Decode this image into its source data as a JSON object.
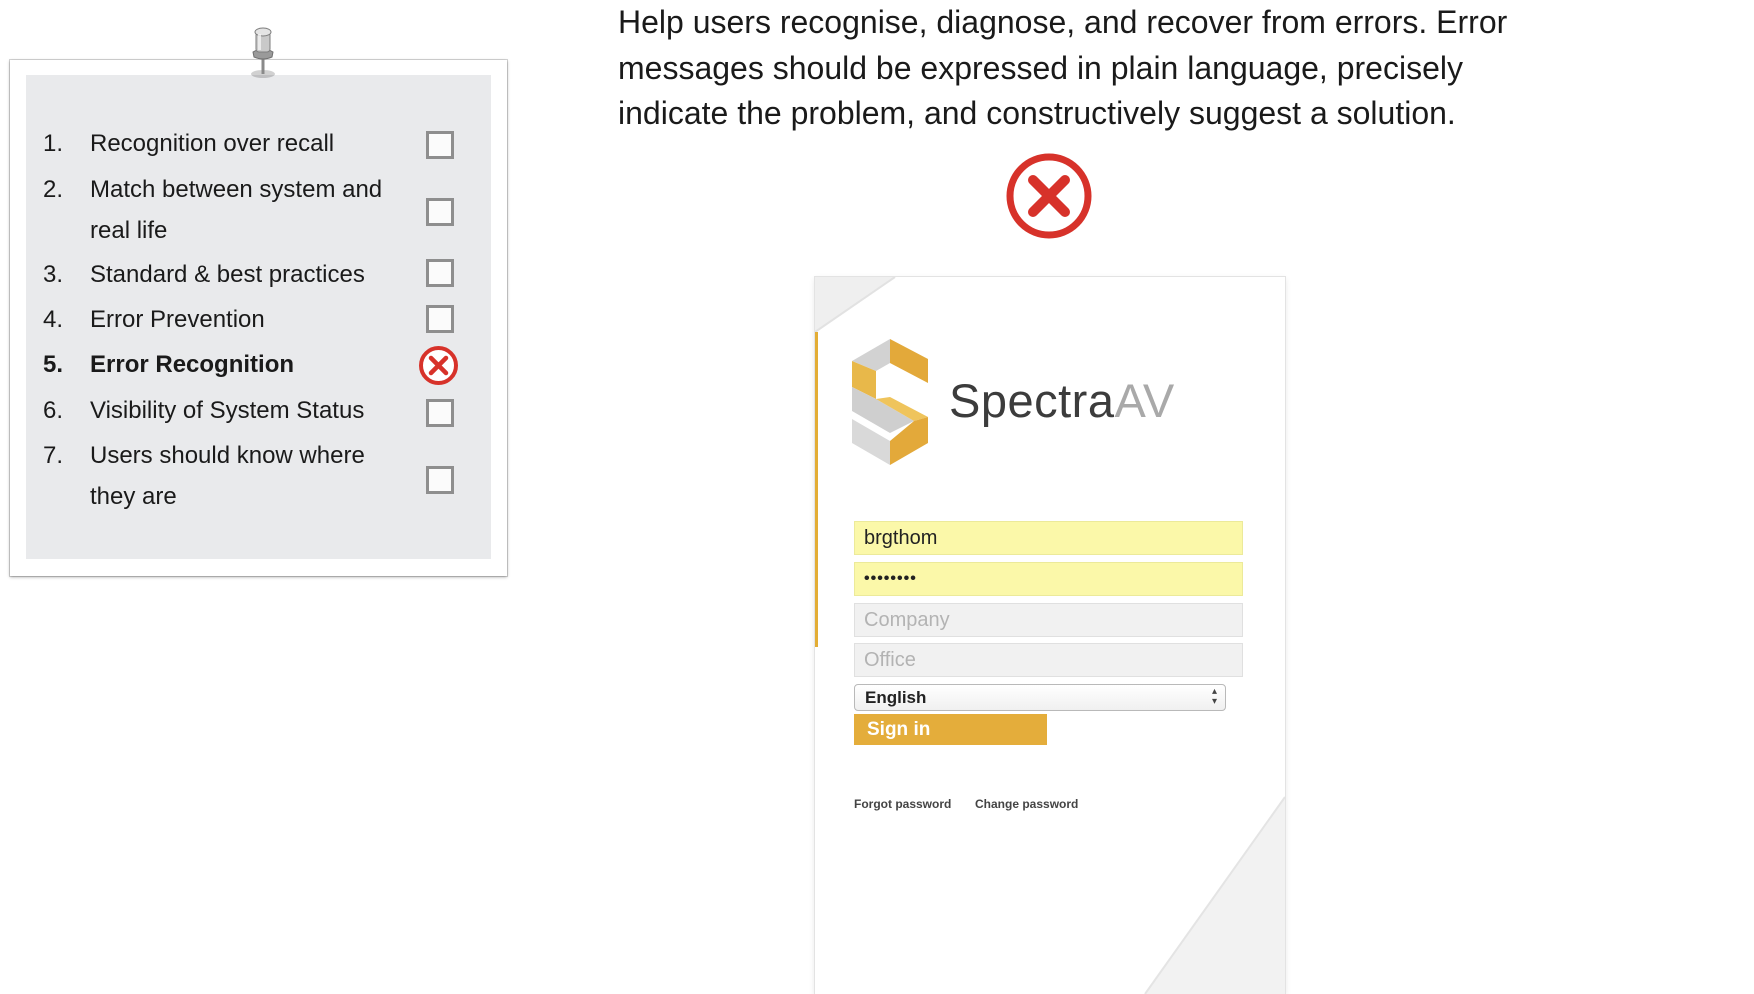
{
  "checklist": {
    "items": [
      {
        "num": "1.",
        "text": "Recognition over recall",
        "status": "unchecked"
      },
      {
        "num": "2.",
        "text": "Match between system and real life",
        "status": "unchecked"
      },
      {
        "num": "3.",
        "text": "Standard & best practices",
        "status": "unchecked"
      },
      {
        "num": "4.",
        "text": "Error Prevention",
        "status": "unchecked"
      },
      {
        "num": "5.",
        "text": "Error Recognition",
        "status": "failed"
      },
      {
        "num": "6.",
        "text": "Visibility of System Status",
        "status": "unchecked"
      },
      {
        "num": "7.",
        "text": "Users should know where they are",
        "status": "unchecked"
      }
    ]
  },
  "heading": {
    "text": "Help users recognise, diagnose, and recover from errors. Error\nmessages should be expressed in plain language, precisely\nindicate the problem, and constructively suggest a solution."
  },
  "status_icon": {
    "name": "error-x-icon",
    "color": "#d7322a"
  },
  "login": {
    "brand_main": "Spectra",
    "brand_suffix": "AV",
    "username_value": "brgthom",
    "password_value": "••••••••",
    "company_placeholder": "Company",
    "office_placeholder": "Office",
    "language_selected": "English",
    "signin_label": "Sign in",
    "forgot_label": "Forgot password",
    "change_label": "Change password",
    "accent_color": "#e4ad3b",
    "autofill_color": "#fbf8a9"
  }
}
